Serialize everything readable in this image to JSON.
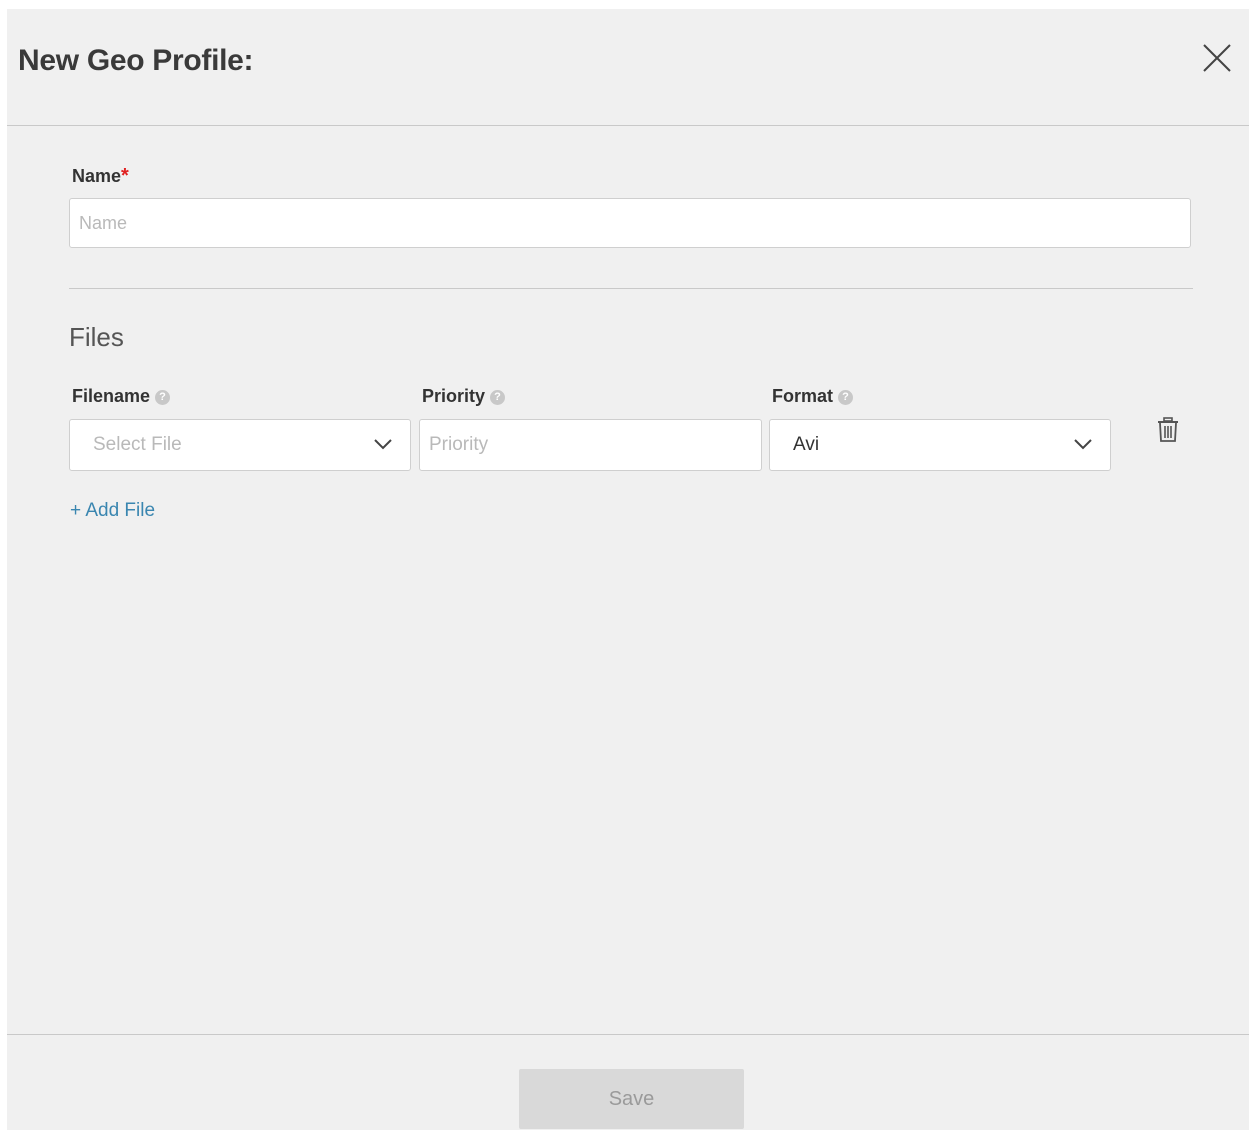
{
  "header": {
    "title": "New Geo Profile:",
    "close_icon": "close-icon"
  },
  "name_field": {
    "label": "Name",
    "required_mark": "*",
    "placeholder": "Name",
    "value": ""
  },
  "files_section": {
    "title": "Files",
    "columns": {
      "filename_label": "Filename",
      "priority_label": "Priority",
      "format_label": "Format"
    },
    "help_icon": "?",
    "rows": [
      {
        "filename_placeholder": "Select File",
        "priority_placeholder": "Priority",
        "priority_value": "",
        "format_value": "Avi"
      }
    ],
    "add_file_label": "+ Add File"
  },
  "footer": {
    "save_label": "Save"
  },
  "colors": {
    "modal_background": "#f0f0f0",
    "link": "#3a86b0",
    "required": "#e02020",
    "disabled_button": "#d9d9d9"
  }
}
